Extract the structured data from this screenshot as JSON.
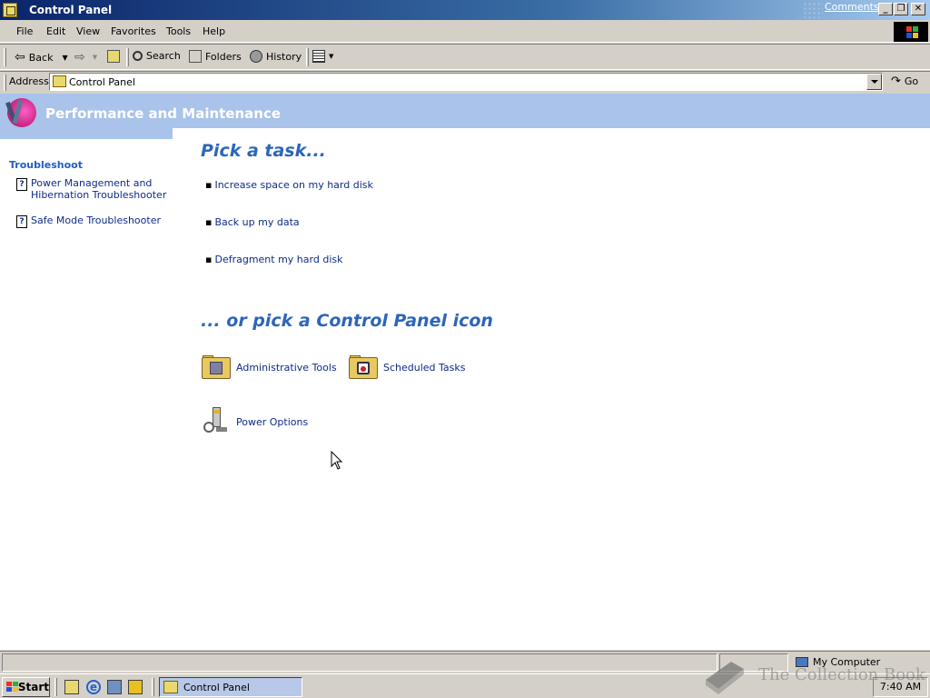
{
  "window": {
    "title": "Control Panel",
    "comments_link": "Comments?",
    "controls": {
      "minimize": "_",
      "restore": "❐",
      "close": "✕"
    }
  },
  "menu": {
    "items": [
      "File",
      "Edit",
      "View",
      "Favorites",
      "Tools",
      "Help"
    ]
  },
  "toolbar": {
    "back": "Back",
    "search": "Search",
    "folders": "Folders",
    "history": "History"
  },
  "address": {
    "label": "Address",
    "value": "Control Panel",
    "go": "Go"
  },
  "banner": {
    "title": "Performance and Maintenance"
  },
  "sidebar": {
    "title": "Troubleshoot",
    "links": [
      {
        "line1": "Power Management and",
        "line2": "Hibernation Troubleshooter",
        "icon": "help-icon"
      },
      {
        "line1": "Safe Mode Troubleshooter",
        "icon": "help-icon"
      }
    ]
  },
  "main": {
    "task_heading": "Pick a task...",
    "tasks": [
      "Increase space on my hard disk",
      "Back up my data",
      "Defragment my hard disk"
    ],
    "icon_heading": "... or pick a Control Panel icon",
    "icons": [
      {
        "label": "Administrative Tools",
        "icon": "administrative-tools-icon"
      },
      {
        "label": "Scheduled Tasks",
        "icon": "scheduled-tasks-icon"
      },
      {
        "label": "Power Options",
        "icon": "power-options-icon"
      }
    ]
  },
  "statusbar": {
    "zone": "My Computer"
  },
  "taskbar": {
    "start": "Start",
    "active_window": "Control Panel",
    "clock": "7:40 AM"
  },
  "watermark": {
    "text": "The Collection Book"
  },
  "colors": {
    "banner": "#a9c3ea",
    "heading": "#2d66b8",
    "link": "#0d2b88",
    "sidebar_title": "#215dc6"
  }
}
